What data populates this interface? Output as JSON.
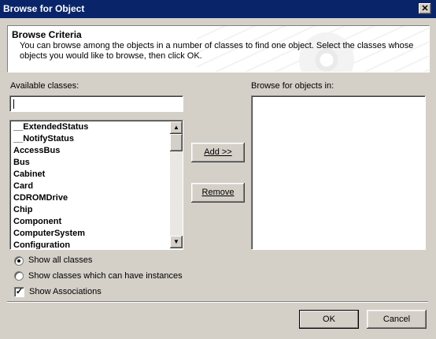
{
  "window": {
    "title": "Browse for Object",
    "close_glyph": "✕"
  },
  "header": {
    "title": "Browse Criteria",
    "description": "You can browse among the objects in a number of classes to find one object.  Select the classes whose objects you would like to browse, then click OK."
  },
  "available": {
    "label": "Available classes:",
    "filter_value": "",
    "items": [
      "__ExtendedStatus",
      "__NotifyStatus",
      "AccessBus",
      "Bus",
      "Cabinet",
      "Card",
      "CDROMDrive",
      "Chip",
      "Component",
      "ComputerSystem",
      "Configuration"
    ]
  },
  "browse_in": {
    "label": "Browse for objects in:"
  },
  "buttons": {
    "add": "Add >>",
    "remove": "Remove",
    "ok": "OK",
    "cancel": "Cancel"
  },
  "options": {
    "show_all": {
      "label": "Show all classes",
      "selected": true
    },
    "show_instances": {
      "label": "Show classes which can have instances",
      "selected": false
    },
    "show_associations": {
      "label": "Show Associations",
      "checked": true
    }
  },
  "icons": {
    "scroll_up": "▲",
    "scroll_down": "▼",
    "check": "✓"
  }
}
